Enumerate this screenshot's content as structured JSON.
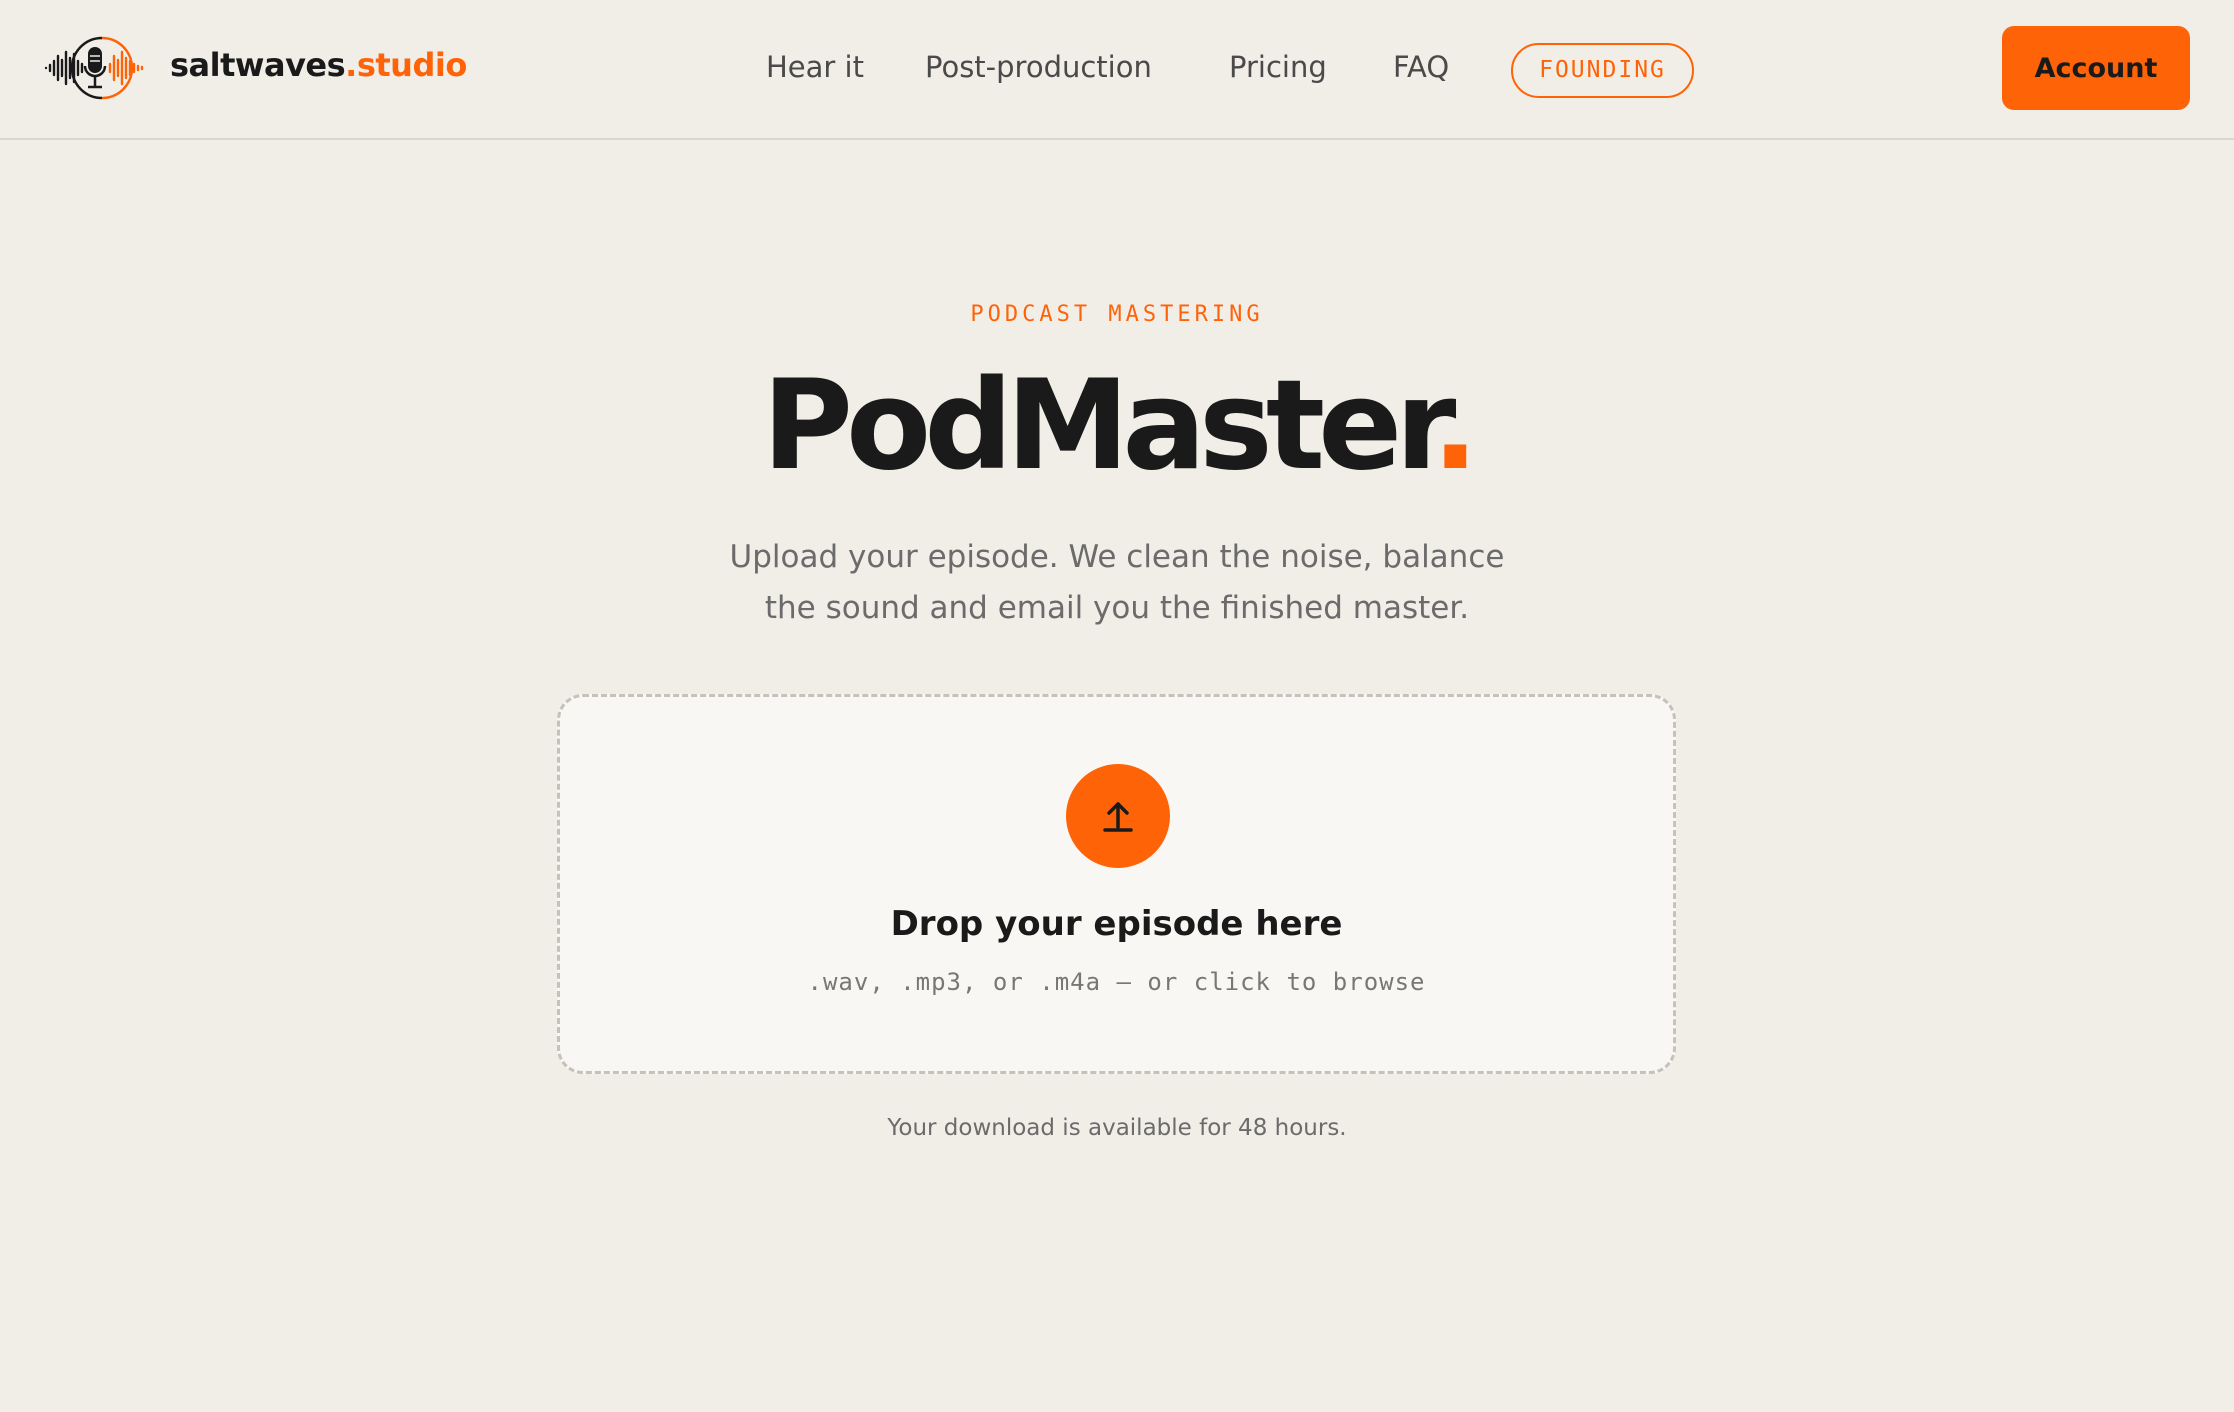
{
  "brand": {
    "name": "saltwaves",
    "suffix": ".studio",
    "logo_icon": "microphone-waveform-icon"
  },
  "nav": {
    "items": [
      {
        "label": "Hear it"
      },
      {
        "label": "Post-production"
      },
      {
        "label": "Pricing"
      },
      {
        "label": "FAQ"
      }
    ],
    "badge_label": "FOUNDING",
    "account_label": "Account"
  },
  "hero": {
    "eyebrow": "PODCAST MASTERING",
    "title": "PodMaster",
    "title_dot": ".",
    "subtitle_line1": "Upload your episode. We clean the noise, balance",
    "subtitle_line2": "the sound and email you the finished master."
  },
  "dropzone": {
    "icon": "upload-arrow-icon",
    "title": "Drop your episode here",
    "hint": ".wav, .mp3, or .m4a — or click to browse"
  },
  "footnote": "Your download is available for 48 hours.",
  "colors": {
    "accent": "#ff6308",
    "background": "#f1eee8",
    "text": "#1a1a1a",
    "muted": "#6b6b6b"
  }
}
